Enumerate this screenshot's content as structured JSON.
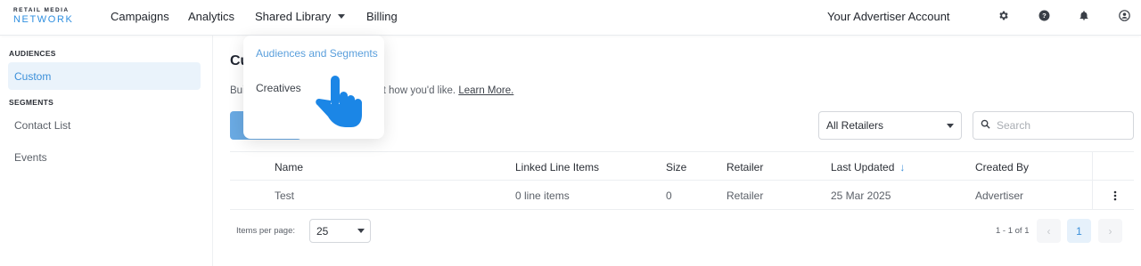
{
  "logo": {
    "line1": "RETAIL MEDIA",
    "line2": "NETWORK"
  },
  "nav": {
    "campaigns": "Campaigns",
    "analytics": "Analytics",
    "shared_library": "Shared Library",
    "billing": "Billing",
    "account": "Your Advertiser Account"
  },
  "icons": [
    "gear-icon",
    "help-icon",
    "bell-icon",
    "user-icon"
  ],
  "dropdown": {
    "items": [
      "Audiences and Segments",
      "Creatives"
    ],
    "selected": "Audiences and Segments"
  },
  "sidebar": {
    "audiences_heading": "AUDIENCES",
    "custom": "Custom",
    "segments_heading": "SEGMENTS",
    "contact_list": "Contact List",
    "events": "Events"
  },
  "main": {
    "title_visible": "Cu",
    "description_prefix": "Bui",
    "description_suffix": "n people just how you'd like.",
    "learn_more": "Learn More."
  },
  "filters": {
    "retailer_select": "All Retailers",
    "search_placeholder": "Search"
  },
  "table": {
    "headers": {
      "name": "Name",
      "linked": "Linked Line Items",
      "size": "Size",
      "retailer": "Retailer",
      "updated": "Last Updated",
      "created": "Created By"
    },
    "rows": [
      {
        "name": "Test",
        "linked": "0 line items",
        "size": "0",
        "retailer": "Retailer",
        "updated": "25 Mar 2025",
        "created": "Advertiser"
      }
    ]
  },
  "pagination": {
    "items_per_page_label": "Items per page:",
    "items_per_page": "25",
    "range": "1 - 1 of 1",
    "current_page": "1",
    "prev": "‹",
    "next": "›"
  },
  "colors": {
    "accent": "#3b8fd9",
    "button": "#6aaae3",
    "active_bg": "#eaf3fb"
  }
}
